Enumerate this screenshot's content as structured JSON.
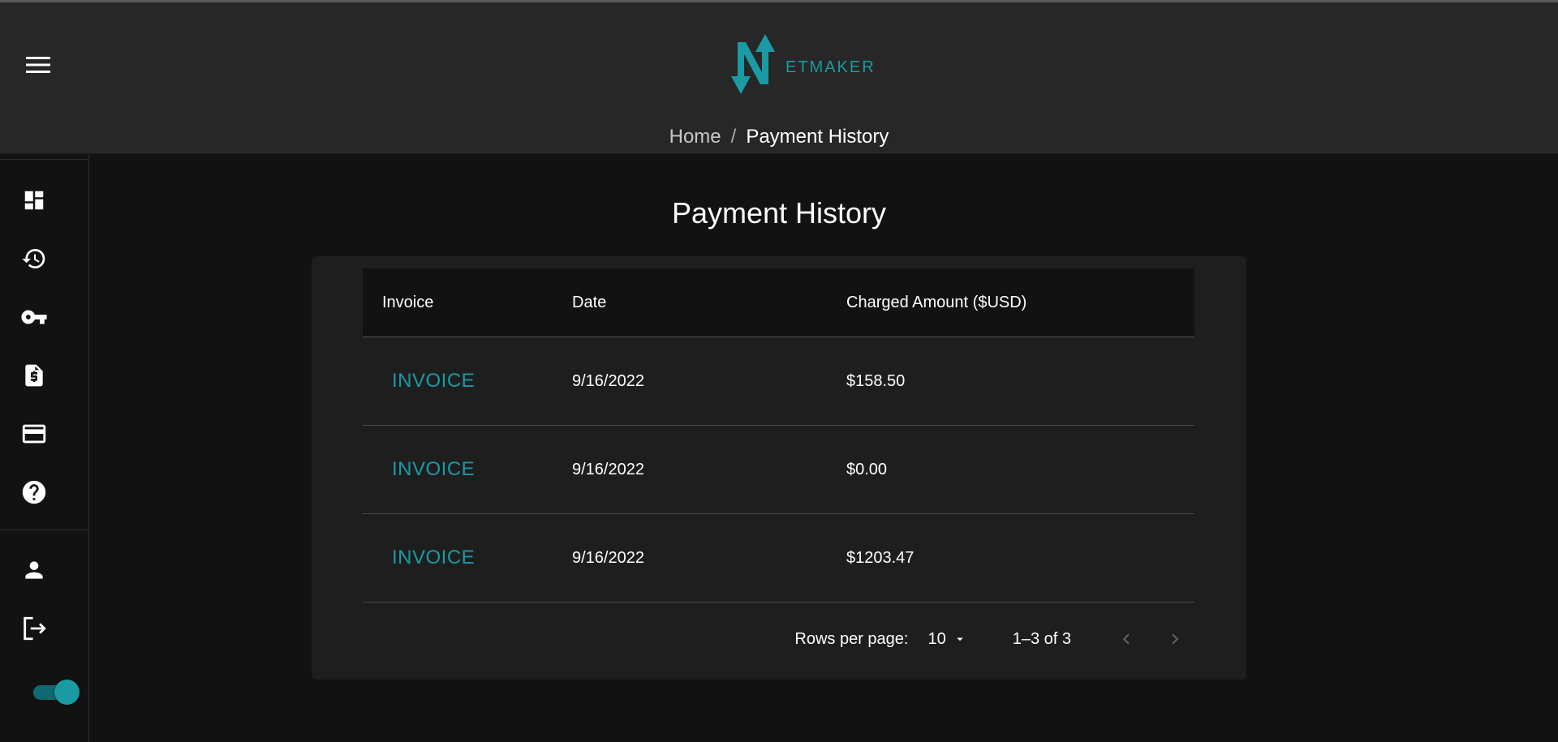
{
  "header": {
    "logo_text": "ETMAKER",
    "breadcrumb": {
      "home": "Home",
      "separator": "/",
      "current": "Payment History"
    }
  },
  "sidebar": {
    "items": [
      {
        "icon": "dashboard-icon"
      },
      {
        "icon": "history-icon"
      },
      {
        "icon": "key-icon"
      },
      {
        "icon": "invoice-icon"
      },
      {
        "icon": "credit-card-icon"
      },
      {
        "icon": "help-icon"
      },
      {
        "icon": "account-icon"
      },
      {
        "icon": "logout-icon"
      }
    ],
    "theme_toggle_on": true
  },
  "main": {
    "title": "Payment History",
    "table": {
      "columns": [
        "Invoice",
        "Date",
        "Charged Amount ($USD)"
      ],
      "rows": [
        {
          "invoice": "INVOICE",
          "date": "9/16/2022",
          "amount": "$158.50"
        },
        {
          "invoice": "INVOICE",
          "date": "9/16/2022",
          "amount": "$0.00"
        },
        {
          "invoice": "INVOICE",
          "date": "9/16/2022",
          "amount": "$1203.47"
        }
      ]
    },
    "pagination": {
      "rows_per_page_label": "Rows per page:",
      "rows_per_page": "10",
      "range": "1–3 of 3"
    }
  },
  "colors": {
    "accent": "#1a9aa3",
    "header_bg": "#272727",
    "page_bg": "#121212",
    "card_bg": "#1e1e1e"
  }
}
